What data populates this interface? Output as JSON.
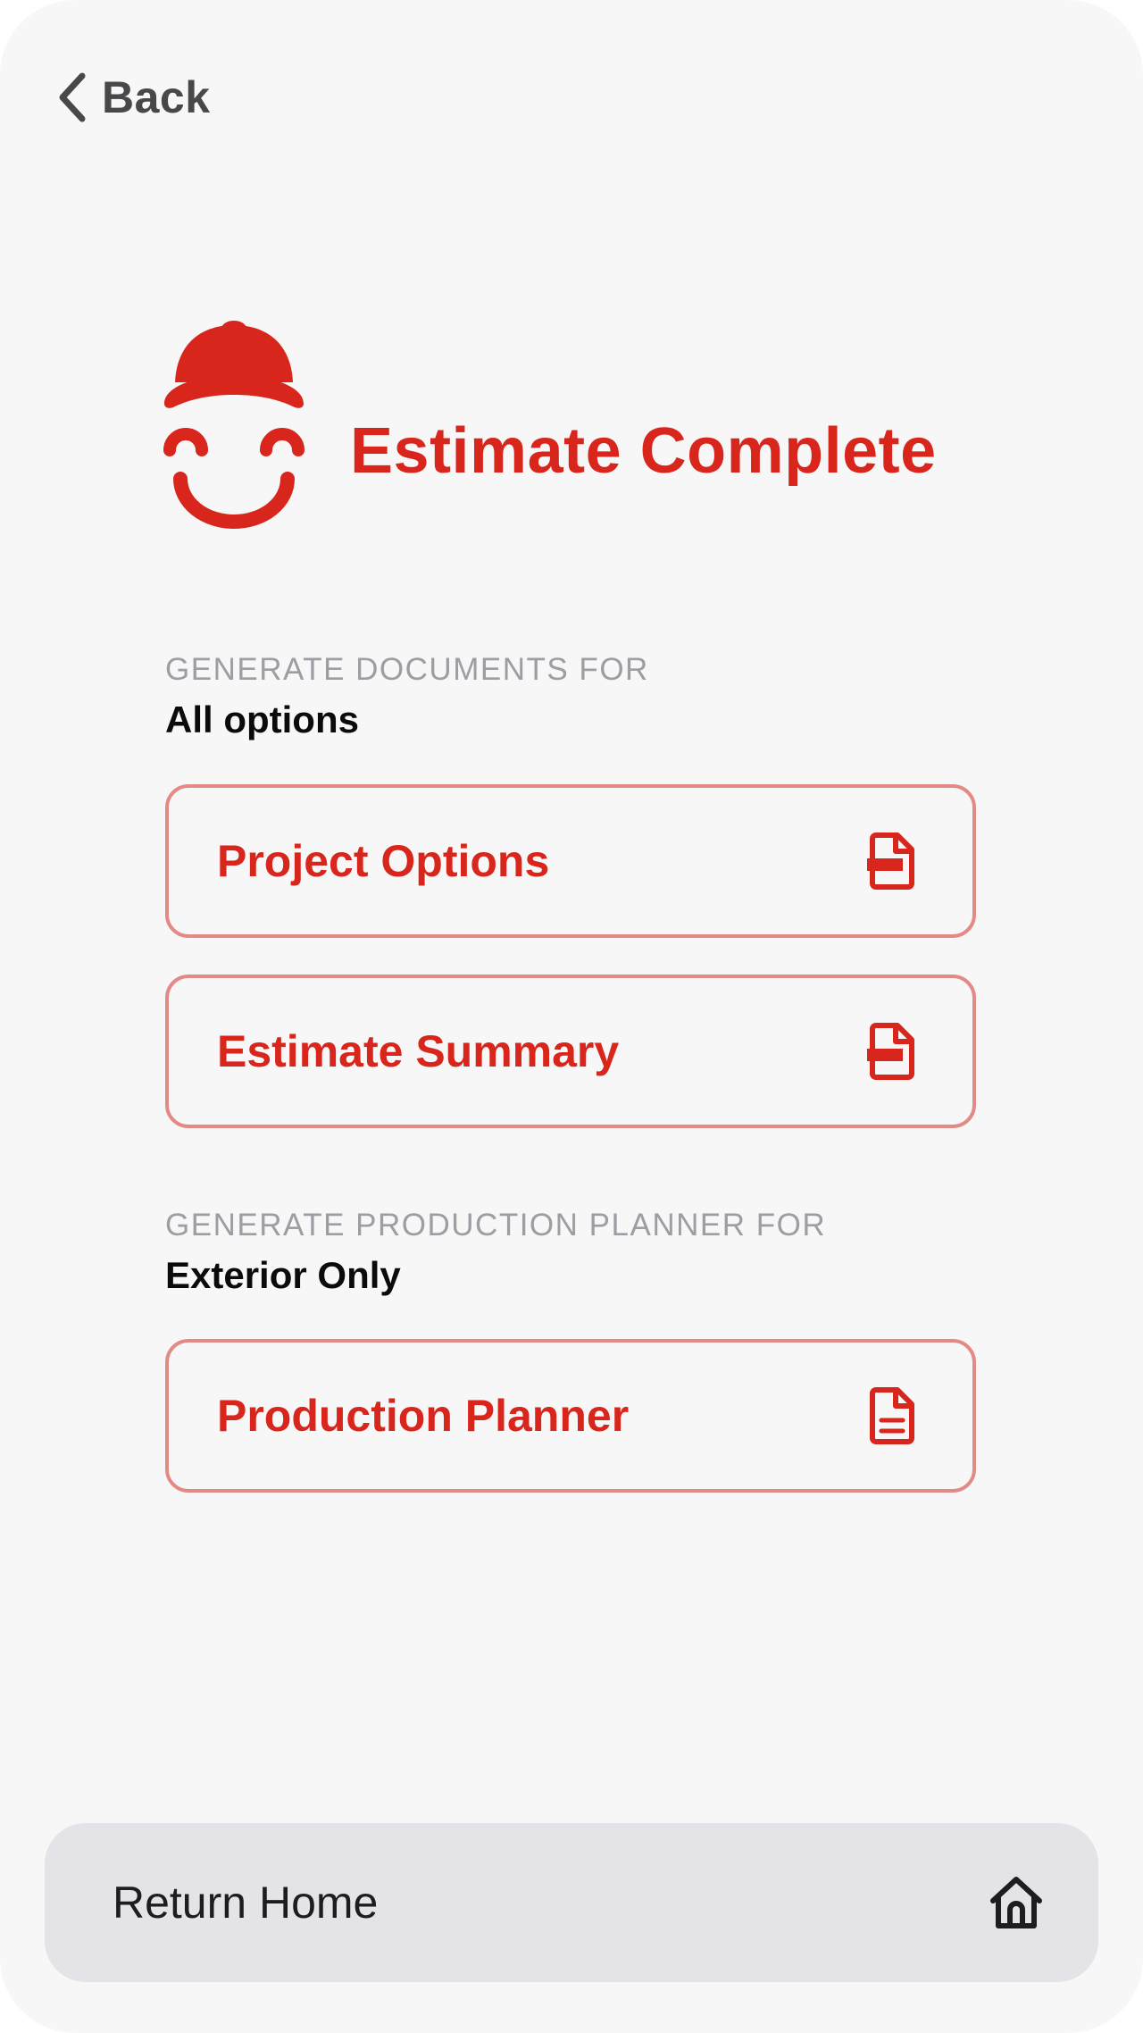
{
  "header": {
    "back_label": "Back"
  },
  "brand": {
    "title": "Estimate Complete",
    "logo_icon": "smiling-painter-cap-icon",
    "accent_color": "#d9261c"
  },
  "documents_section": {
    "label": "GENERATE DOCUMENTS FOR",
    "value": "All options",
    "buttons": [
      {
        "label": "Project Options",
        "icon": "pdf-file-icon"
      },
      {
        "label": "Estimate Summary",
        "icon": "pdf-file-icon"
      }
    ]
  },
  "planner_section": {
    "label": "GENERATE PRODUCTION PLANNER FOR",
    "value": "Exterior Only",
    "buttons": [
      {
        "label": "Production Planner",
        "icon": "text-file-icon"
      }
    ]
  },
  "footer": {
    "return_label": "Return Home",
    "icon": "home-icon"
  }
}
